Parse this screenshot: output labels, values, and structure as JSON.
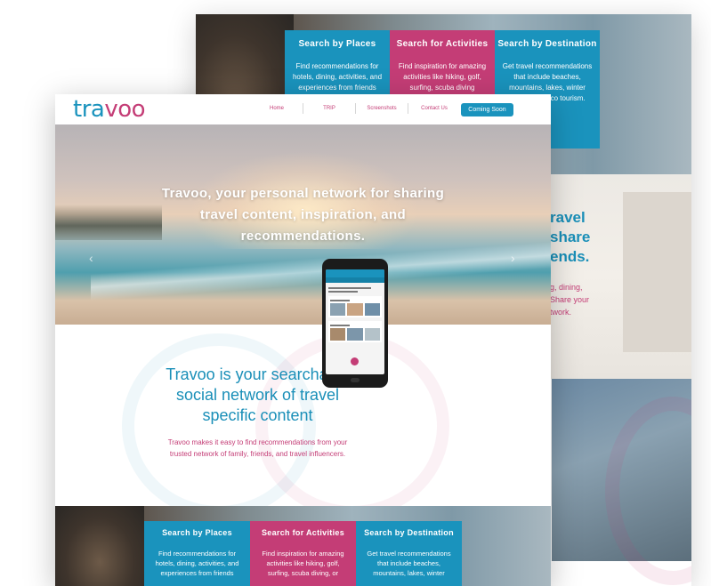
{
  "back": {
    "cards": [
      {
        "title": "Search by Places",
        "desc": "Find recommendations for hotels, dining, activities, and experiences from friends",
        "color": "#1a93bd"
      },
      {
        "title": "Search for Activities",
        "desc": "Find inspiration for amazing activities like hiking, golf, surfing, scuba diving",
        "color": "#c43d76"
      },
      {
        "title": "Search by Destination",
        "desc": "Get travel recommendations that include beaches, mountains, lakes, winter sports, and eco tourism.",
        "color": "#1a93bd"
      }
    ],
    "partial_title": "ravel\nshare\nends.",
    "partial_sub": "g, dining,\nShare your\ntwork."
  },
  "nav": {
    "logo_part1": "tra",
    "logo_part2": "voo",
    "items": [
      "Home",
      "TRIP",
      "Screenshots",
      "Contact Us"
    ],
    "cta": "Coming Soon"
  },
  "hero": {
    "headline": "Travoo, your personal network for sharing travel content, inspiration, and recommendations.",
    "prev_icon": "‹",
    "next_icon": "›"
  },
  "social": {
    "title": "Travoo is your searchable social network of travel specific content",
    "subtitle": "Travoo makes it easy to find  recommendations from your trusted network of family, friends, and travel influencers."
  },
  "features": [
    {
      "title": "Search by Places",
      "desc": "Find recommendations for hotels, dining, activities, and experiences from friends",
      "color": "#1a93bd"
    },
    {
      "title": "Search for Activities",
      "desc": "Find inspiration for amazing activities like hiking, golf, surfing, scuba diving, or",
      "color": "#c43d76"
    },
    {
      "title": "Search by Destination",
      "desc": "Get travel recommendations that include beaches, mountains, lakes, winter",
      "color": "#1a93bd"
    }
  ],
  "colors": {
    "brand_blue": "#1a93bd",
    "brand_pink": "#c43d76"
  }
}
